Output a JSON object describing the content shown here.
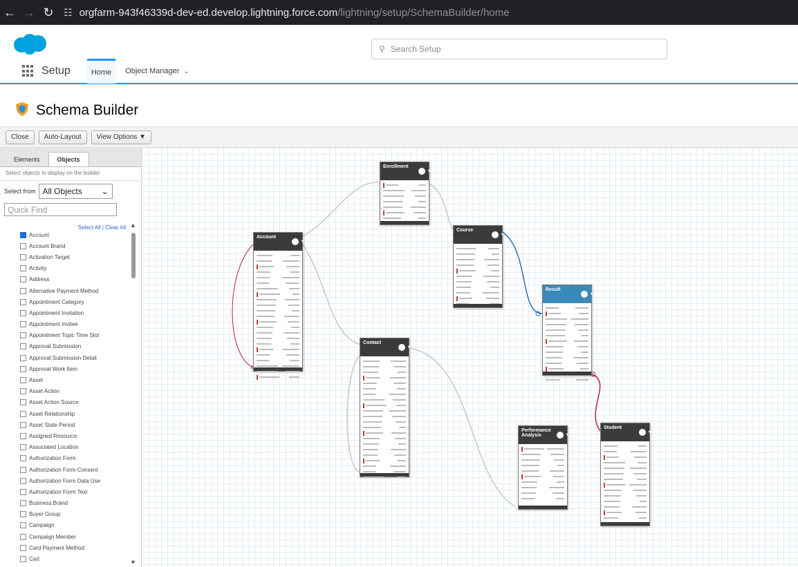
{
  "browser": {
    "url_host": "orgfarm-943f46339d-dev-ed.develop.lightning.force.com",
    "url_path": "/lightning/setup/SchemaBuilder/home"
  },
  "header": {
    "search_placeholder": "Search Setup"
  },
  "nav": {
    "app_title": "Setup",
    "tabs": [
      {
        "label": "Home"
      },
      {
        "label": "Object Manager"
      }
    ]
  },
  "page": {
    "title": "Schema Builder"
  },
  "toolbar": {
    "close": "Close",
    "auto_layout": "Auto-Layout",
    "view_options": "View Options ▼"
  },
  "sidebar": {
    "tabs": [
      {
        "label": "Elements"
      },
      {
        "label": "Objects"
      }
    ],
    "hint": "Select objects to display on the builder",
    "select_label": "Select from",
    "select_value": "All Objects",
    "quick_find_placeholder": "Quick Find",
    "select_all": "Select All",
    "clear_all": "Clear All",
    "objects": [
      {
        "label": "Account",
        "checked": true
      },
      {
        "label": "Account Brand",
        "checked": false
      },
      {
        "label": "Activation Target",
        "checked": false
      },
      {
        "label": "Activity",
        "checked": false
      },
      {
        "label": "Address",
        "checked": false
      },
      {
        "label": "Alternative Payment Method",
        "checked": false
      },
      {
        "label": "Appointment Category",
        "checked": false
      },
      {
        "label": "Appointment Invitation",
        "checked": false
      },
      {
        "label": "Appointment Invitee",
        "checked": false
      },
      {
        "label": "Appointment Topic Time Slot",
        "checked": false
      },
      {
        "label": "Approval Submission",
        "checked": false
      },
      {
        "label": "Approval Submission Detail",
        "checked": false
      },
      {
        "label": "Approval Work Item",
        "checked": false
      },
      {
        "label": "Asset",
        "checked": false
      },
      {
        "label": "Asset Action",
        "checked": false
      },
      {
        "label": "Asset Action Source",
        "checked": false
      },
      {
        "label": "Asset Relationship",
        "checked": false
      },
      {
        "label": "Asset State Period",
        "checked": false
      },
      {
        "label": "Assigned Resource",
        "checked": false
      },
      {
        "label": "Associated Location",
        "checked": false
      },
      {
        "label": "Authorization Form",
        "checked": false
      },
      {
        "label": "Authorization Form Consent",
        "checked": false
      },
      {
        "label": "Authorization Form Data Use",
        "checked": false
      },
      {
        "label": "Authorization Form Text",
        "checked": false
      },
      {
        "label": "Business Brand",
        "checked": false
      },
      {
        "label": "Buyer Group",
        "checked": false
      },
      {
        "label": "Campaign",
        "checked": false
      },
      {
        "label": "Campaign Member",
        "checked": false
      },
      {
        "label": "Card Payment Method",
        "checked": false
      },
      {
        "label": "Cart",
        "checked": false
      }
    ]
  },
  "canvas": {
    "nodes": [
      {
        "id": "enrollment",
        "title": "Enrollment",
        "rows": 8
      },
      {
        "id": "account",
        "title": "Account",
        "rows": 23
      },
      {
        "id": "course",
        "title": "Course",
        "rows": 11
      },
      {
        "id": "result",
        "title": "Result",
        "rows": 14,
        "highlighted": true
      },
      {
        "id": "contact",
        "title": "Contact",
        "rows": 22
      },
      {
        "id": "performance",
        "title": "Performance Analysis",
        "rows": 10
      },
      {
        "id": "student",
        "title": "Student",
        "rows": 15
      }
    ],
    "colors": {
      "lookup_link": "#c8c8c8",
      "master_detail_blue": "#2f6fb5",
      "master_detail_red": "#b2253a"
    }
  }
}
